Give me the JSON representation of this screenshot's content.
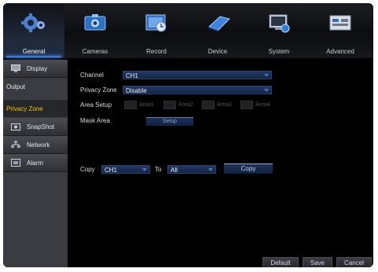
{
  "menu": {
    "tabs": [
      {
        "label": "General",
        "icon": "gears-icon"
      },
      {
        "label": "Cameras",
        "icon": "camera-icon"
      },
      {
        "label": "Record",
        "icon": "record-icon"
      },
      {
        "label": "Device",
        "icon": "disk-icon"
      },
      {
        "label": "System",
        "icon": "monitor-icon"
      },
      {
        "label": "Advanced",
        "icon": "advanced-icon"
      }
    ],
    "active": "General"
  },
  "sidebar": {
    "items": [
      {
        "label": "Display"
      },
      {
        "label": "Output"
      },
      {
        "label": "Privacy Zone"
      },
      {
        "label": "SnapShot"
      },
      {
        "label": "Network"
      },
      {
        "label": "Alarm"
      }
    ]
  },
  "form": {
    "channel_label": "Channel",
    "channel_value": "CH1",
    "privacy_label": "Privacy Zone",
    "privacy_value": "Disable",
    "area_setup_label": "Area Setup",
    "areas": [
      "Area1",
      "Area2",
      "Area3",
      "Area4"
    ],
    "mask_area_label": "Mask Area",
    "setup_button": "Setup",
    "copy_label": "Copy",
    "copy_from": "CH1",
    "to_label": "To",
    "copy_to": "All",
    "copy_button": "Copy"
  },
  "footer": {
    "default_button": "Default",
    "save_button": "Save",
    "cancel_button": "Cancel"
  },
  "colors": {
    "accent": "#3a78d8",
    "active_text": "#f0c400",
    "field_bg": "#1a2d54"
  }
}
